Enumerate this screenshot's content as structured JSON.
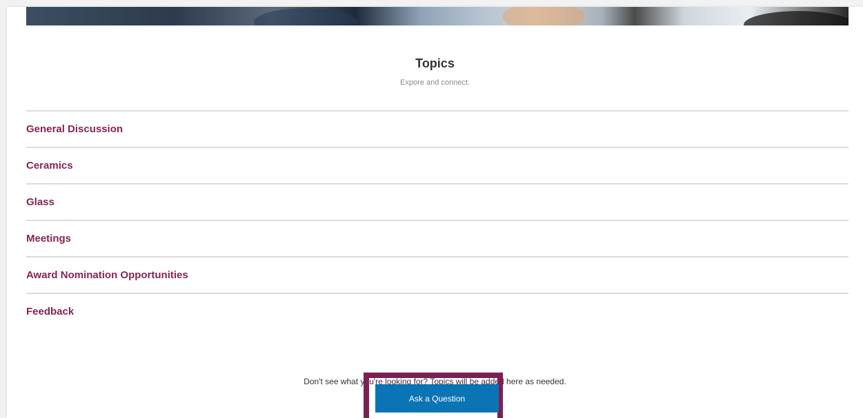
{
  "section": {
    "title": "Topics",
    "subtitle": "Expore and connect."
  },
  "topics": [
    {
      "label": "General Discussion"
    },
    {
      "label": "Ceramics"
    },
    {
      "label": "Glass"
    },
    {
      "label": "Meetings"
    },
    {
      "label": "Award Nomination Opportunities"
    },
    {
      "label": "Feedback"
    }
  ],
  "footer": {
    "helper_text": "Don't see what you're looking for? Topics will be added here as needed.",
    "ask_button_label": "Ask a Question"
  },
  "colors": {
    "topic_link": "#862555",
    "button": "#0b74b5",
    "highlight_border": "#7e1f54"
  }
}
